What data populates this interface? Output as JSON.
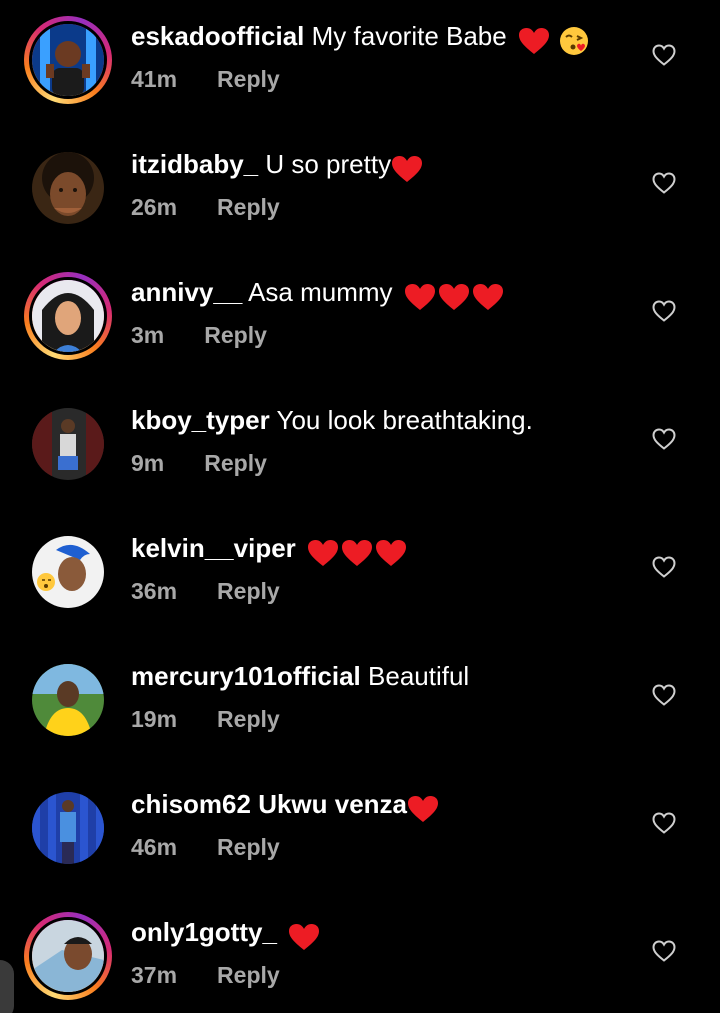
{
  "accent": {
    "heart": "#ed1c24",
    "muted": "#a8a8a8",
    "background": "#000000"
  },
  "comments": [
    {
      "username": "eskadoofficial",
      "text": "My favorite Babe",
      "emoji": [
        "red-heart",
        "face-blowing-kiss"
      ],
      "time": "41m",
      "reply": "Reply",
      "story_ring": true
    },
    {
      "username": "itzidbaby_",
      "text": "U so pretty",
      "emoji": [
        "red-heart"
      ],
      "time": "26m",
      "reply": "Reply",
      "story_ring": false
    },
    {
      "username": "annivy__",
      "text": "Asa mummy",
      "emoji": [
        "red-heart",
        "red-heart",
        "red-heart"
      ],
      "time": "3m",
      "reply": "Reply",
      "story_ring": true
    },
    {
      "username": "kboy_typer",
      "text": "You look breathtaking.",
      "emoji": [],
      "time": "9m",
      "reply": "Reply",
      "story_ring": false
    },
    {
      "username": "kelvin__viper",
      "text": "",
      "emoji": [
        "red-heart",
        "red-heart",
        "red-heart"
      ],
      "time": "36m",
      "reply": "Reply",
      "story_ring": false
    },
    {
      "username": "mercury101official",
      "text": "Beautiful",
      "emoji": [],
      "time": "19m",
      "reply": "Reply",
      "story_ring": false
    },
    {
      "username": "chisom62",
      "text": "Ukwu venza",
      "emoji": [
        "red-heart"
      ],
      "time": "46m",
      "reply": "Reply",
      "story_ring": false
    },
    {
      "username": "only1gotty_",
      "text": "",
      "emoji": [
        "red-heart"
      ],
      "time": "37m",
      "reply": "Reply",
      "story_ring": true
    }
  ]
}
